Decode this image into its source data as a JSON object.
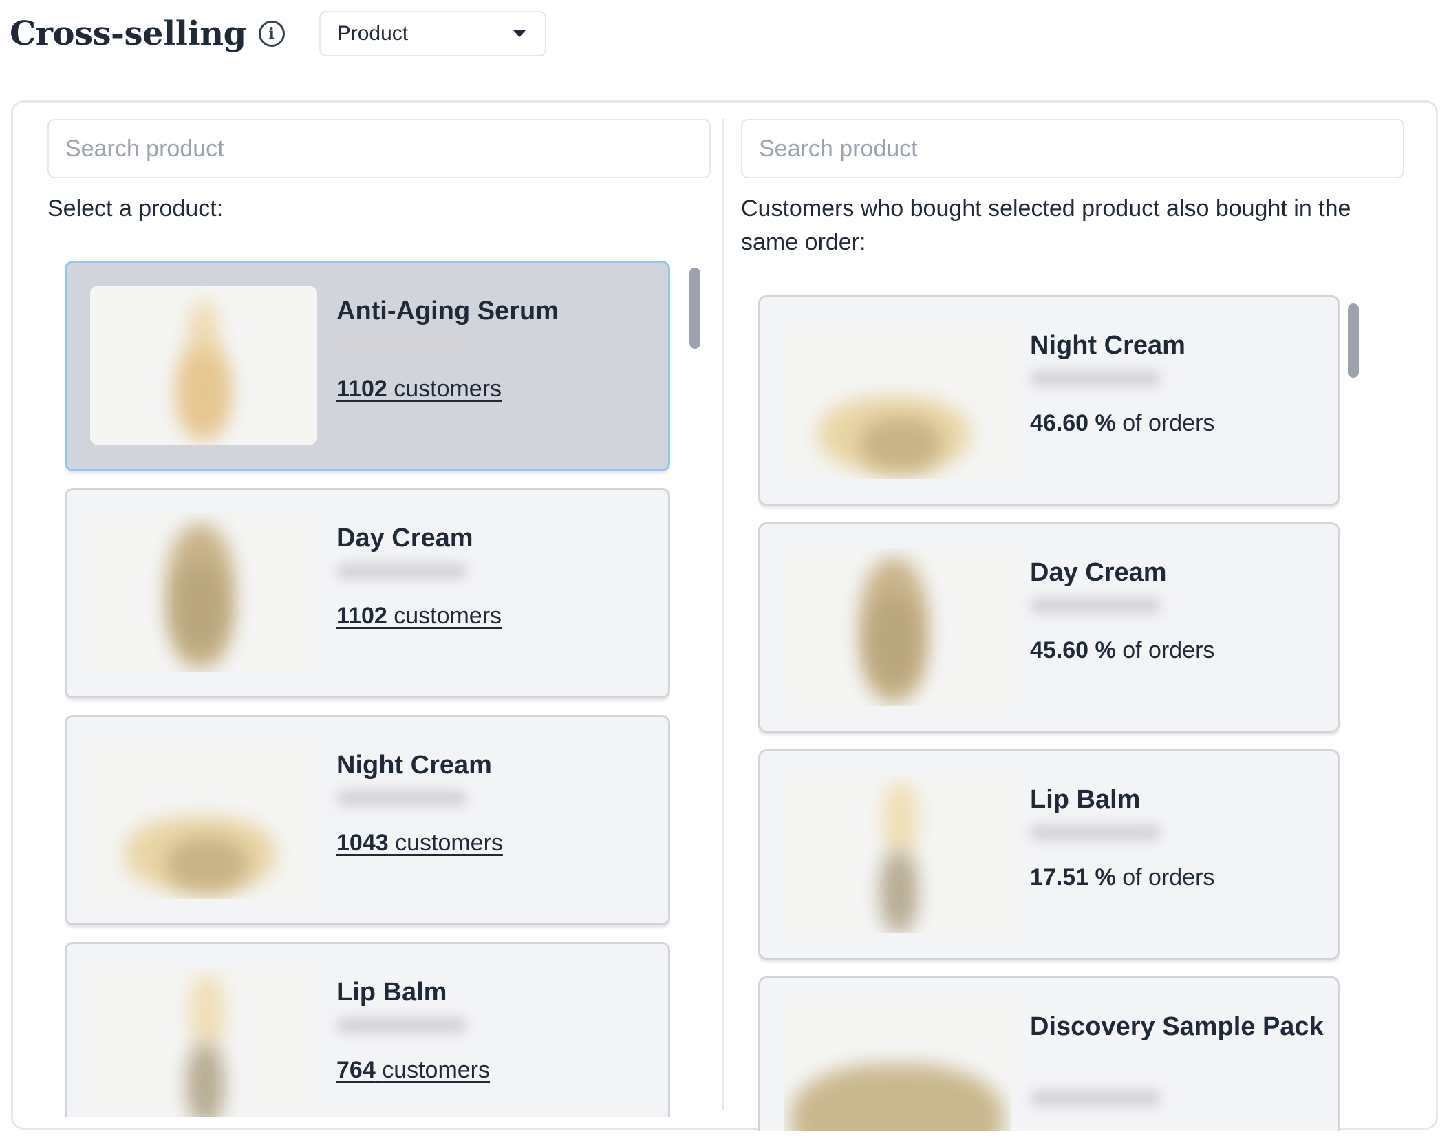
{
  "header": {
    "title": "Cross-selling",
    "info_icon": "info-icon",
    "dropdown": {
      "selected": "Product"
    }
  },
  "left": {
    "search_placeholder": "Search product",
    "prompt": "Select a product:",
    "items": [
      {
        "name": "Anti-Aging Serum",
        "count": "1102",
        "unit": "customers",
        "selected": true
      },
      {
        "name": "Day Cream",
        "count": "1102",
        "unit": "customers"
      },
      {
        "name": "Night Cream",
        "count": "1043",
        "unit": "customers"
      },
      {
        "name": "Lip Balm",
        "count": "764",
        "unit": "customers"
      }
    ]
  },
  "right": {
    "search_placeholder": "Search product",
    "prompt": "Customers who bought selected product also bought in the same order:",
    "items": [
      {
        "name": "Night Cream",
        "percent": "46.60 %",
        "unit": "of orders"
      },
      {
        "name": "Day Cream",
        "percent": "45.60 %",
        "unit": "of orders"
      },
      {
        "name": "Lip Balm",
        "percent": "17.51 %",
        "unit": "of orders"
      },
      {
        "name": "Discovery Sample Pack",
        "percent": "",
        "unit": ""
      }
    ]
  },
  "colors": {
    "card_bg": "#f3f4f6",
    "selected_bg": "#d1d5db",
    "selected_border": "#93c5fd",
    "text": "#1f2937",
    "placeholder": "#9ca3af"
  }
}
